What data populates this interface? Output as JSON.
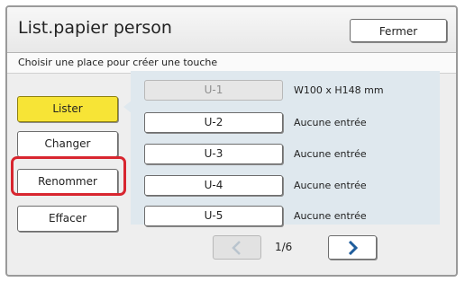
{
  "window": {
    "title": "List.papier person",
    "close_label": "Fermer"
  },
  "instruction": "Choisir une place pour créer une touche",
  "actions": [
    {
      "label": "Lister",
      "active": true
    },
    {
      "label": "Changer",
      "active": false
    },
    {
      "label": "Renommer",
      "active": false,
      "highlighted": true
    },
    {
      "label": "Effacer",
      "active": false
    }
  ],
  "slots": [
    {
      "label": "U-1",
      "description": "W100 x H148 mm",
      "enabled": false
    },
    {
      "label": "U-2",
      "description": "Aucune entrée",
      "enabled": true
    },
    {
      "label": "U-3",
      "description": "Aucune entrée",
      "enabled": true
    },
    {
      "label": "U-4",
      "description": "Aucune entrée",
      "enabled": true
    },
    {
      "label": "U-5",
      "description": "Aucune entrée",
      "enabled": true
    }
  ],
  "pagination": {
    "indicator": "1/6",
    "prev_icon": "chevron-left-icon",
    "next_icon": "chevron-right-icon",
    "prev_enabled": false,
    "next_enabled": true
  },
  "colors": {
    "active_button": "#f7e436",
    "highlight_outline": "#d8262f",
    "panel": "#dfe8ee",
    "next_arrow": "#1f5d9c"
  }
}
